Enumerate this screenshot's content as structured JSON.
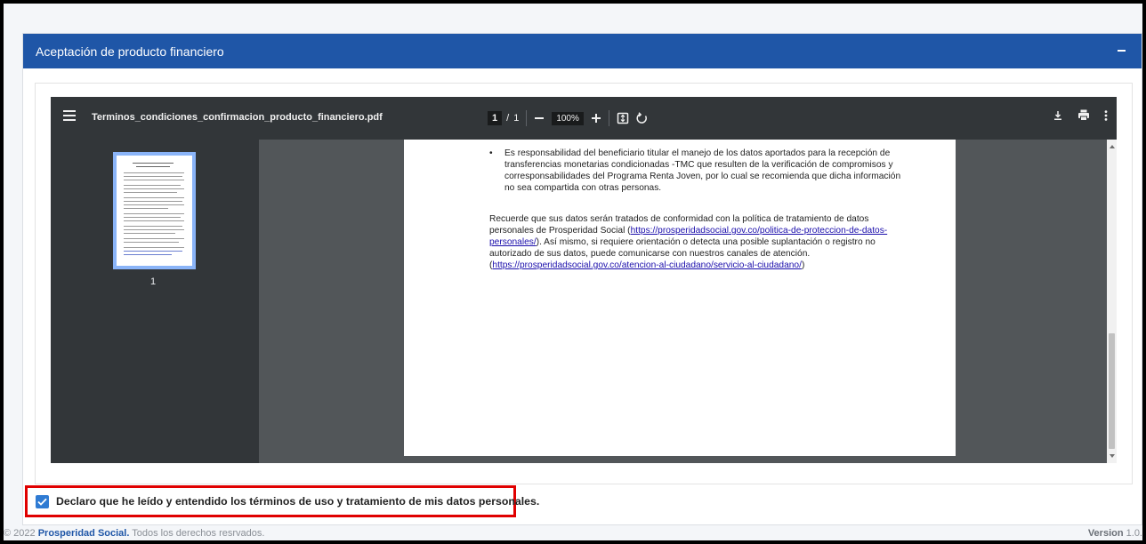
{
  "card": {
    "title": "Aceptación de producto financiero"
  },
  "viewer": {
    "filename": "Terminos_condiciones_confirmacion_producto_financiero.pdf",
    "current_page": "1",
    "page_sep": "/",
    "total_pages": "1",
    "zoom": "100%",
    "thumbnail_label": "1"
  },
  "pdf": {
    "bullet_text": "Es responsabilidad del beneficiario titular el manejo de los datos aportados para la recepción de transferencias monetarias condicionadas -TMC que resulten de la verificación de compromisos y corresponsabilidades del Programa Renta Joven, por lo cual se recomienda que dicha información no sea compartida con otras personas.",
    "para_start": "Recuerde que sus datos serán tratados de conformidad con la política de tratamiento de datos personales de Prosperidad Social (",
    "link1": "https://prosperidadsocial.gov.co/politica-de-proteccion-de-datos-personales/",
    "para_middle": "). Así mismo, si requiere orientación o detecta una posible suplantación o registro no autorizado de sus datos, puede comunicarse con nuestros canales de atención. (",
    "link2": "https://prosperidadsocial.gov.co/atencion-al-ciudadano/servicio-al-ciudadano/",
    "para_end": ")"
  },
  "consent": {
    "checked": true,
    "label": "Declaro que he leído y entendido los términos de uso y tratamiento de mis datos personales."
  },
  "footer": {
    "copyright": "© 2022",
    "brand": "Prosperidad Social.",
    "rights": "Todos los derechos resrvados.",
    "version_label": "Version",
    "version_value": "1.0."
  },
  "colors": {
    "header_bg": "#1f56a7",
    "viewer_toolbar": "#323639",
    "consent_border": "#e00000",
    "checkbox": "#2f7bd3"
  }
}
